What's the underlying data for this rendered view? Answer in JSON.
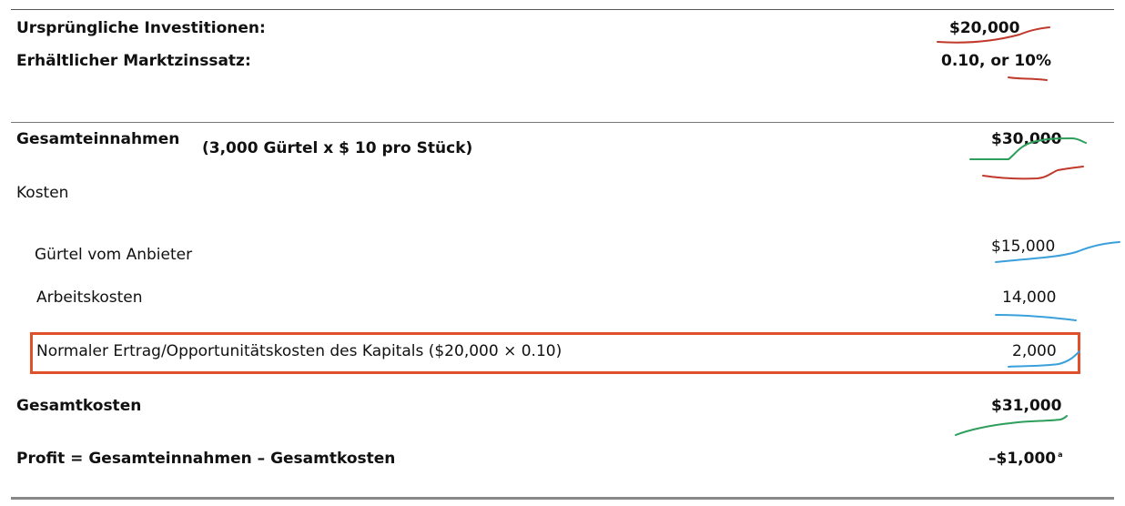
{
  "header": {
    "investment_label": "Ursprüngliche Investitionen:",
    "investment_value": "$20,000",
    "rate_label": "Erhältlicher Marktzinssatz:",
    "rate_value_prefix": "0.10, or ",
    "rate_value_pct": "10%"
  },
  "revenue": {
    "label": "Gesamteinnahmen",
    "note": "(3,000 Gürtel x $ 10 pro Stück)",
    "value": "$30,000"
  },
  "costs": {
    "label": "Kosten",
    "items": [
      {
        "label": "Gürtel vom Anbieter",
        "value": "$15,000"
      },
      {
        "label": "Arbeitskosten",
        "value": "14,000"
      },
      {
        "label": "Normaler Ertrag/Opportunitätskosten des Kapitals ($20,000 × 0.10)",
        "value": "2,000"
      }
    ]
  },
  "total_costs": {
    "label": "Gesamtkosten",
    "value": "$31,000"
  },
  "profit": {
    "label": "Profit = Gesamteinnahmen – Gesamtkosten",
    "value": "–$1,000",
    "footnote": "a"
  },
  "annotation_colors": {
    "red": "#c0392b",
    "green": "#2e9e5b",
    "blue": "#3aa0dc",
    "highlight_box": "#e0502a"
  }
}
